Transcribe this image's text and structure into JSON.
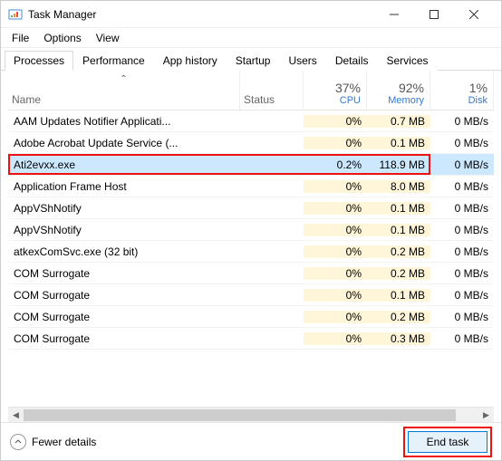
{
  "window": {
    "title": "Task Manager"
  },
  "menu": {
    "file": "File",
    "options": "Options",
    "view": "View"
  },
  "tabs": {
    "processes": "Processes",
    "performance": "Performance",
    "apphistory": "App history",
    "startup": "Startup",
    "users": "Users",
    "details": "Details",
    "services": "Services"
  },
  "columns": {
    "name": "Name",
    "status": "Status",
    "cpu_pct": "37%",
    "cpu_lbl": "CPU",
    "mem_pct": "92%",
    "mem_lbl": "Memory",
    "disk_pct": "1%",
    "disk_lbl": "Disk"
  },
  "rows": [
    {
      "name": "AAM Updates Notifier Applicati...",
      "cpu": "0%",
      "mem": "0.7 MB",
      "disk": "0 MB/s",
      "sel": false,
      "hl": false
    },
    {
      "name": "Adobe Acrobat Update Service (...",
      "cpu": "0%",
      "mem": "0.1 MB",
      "disk": "0 MB/s",
      "sel": false,
      "hl": false
    },
    {
      "name": "Ati2evxx.exe",
      "cpu": "0.2%",
      "mem": "118.9 MB",
      "disk": "0 MB/s",
      "sel": true,
      "hl": true
    },
    {
      "name": "Application Frame Host",
      "cpu": "0%",
      "mem": "8.0 MB",
      "disk": "0 MB/s",
      "sel": false,
      "hl": false
    },
    {
      "name": "AppVShNotify",
      "cpu": "0%",
      "mem": "0.1 MB",
      "disk": "0 MB/s",
      "sel": false,
      "hl": false
    },
    {
      "name": "AppVShNotify",
      "cpu": "0%",
      "mem": "0.1 MB",
      "disk": "0 MB/s",
      "sel": false,
      "hl": false
    },
    {
      "name": "atkexComSvc.exe (32 bit)",
      "cpu": "0%",
      "mem": "0.2 MB",
      "disk": "0 MB/s",
      "sel": false,
      "hl": false
    },
    {
      "name": "COM Surrogate",
      "cpu": "0%",
      "mem": "0.2 MB",
      "disk": "0 MB/s",
      "sel": false,
      "hl": false
    },
    {
      "name": "COM Surrogate",
      "cpu": "0%",
      "mem": "0.1 MB",
      "disk": "0 MB/s",
      "sel": false,
      "hl": false
    },
    {
      "name": "COM Surrogate",
      "cpu": "0%",
      "mem": "0.2 MB",
      "disk": "0 MB/s",
      "sel": false,
      "hl": false
    },
    {
      "name": "COM Surrogate",
      "cpu": "0%",
      "mem": "0.3 MB",
      "disk": "0 MB/s",
      "sel": false,
      "hl": false
    }
  ],
  "footer": {
    "fewer": "Fewer details",
    "endtask": "End task"
  }
}
